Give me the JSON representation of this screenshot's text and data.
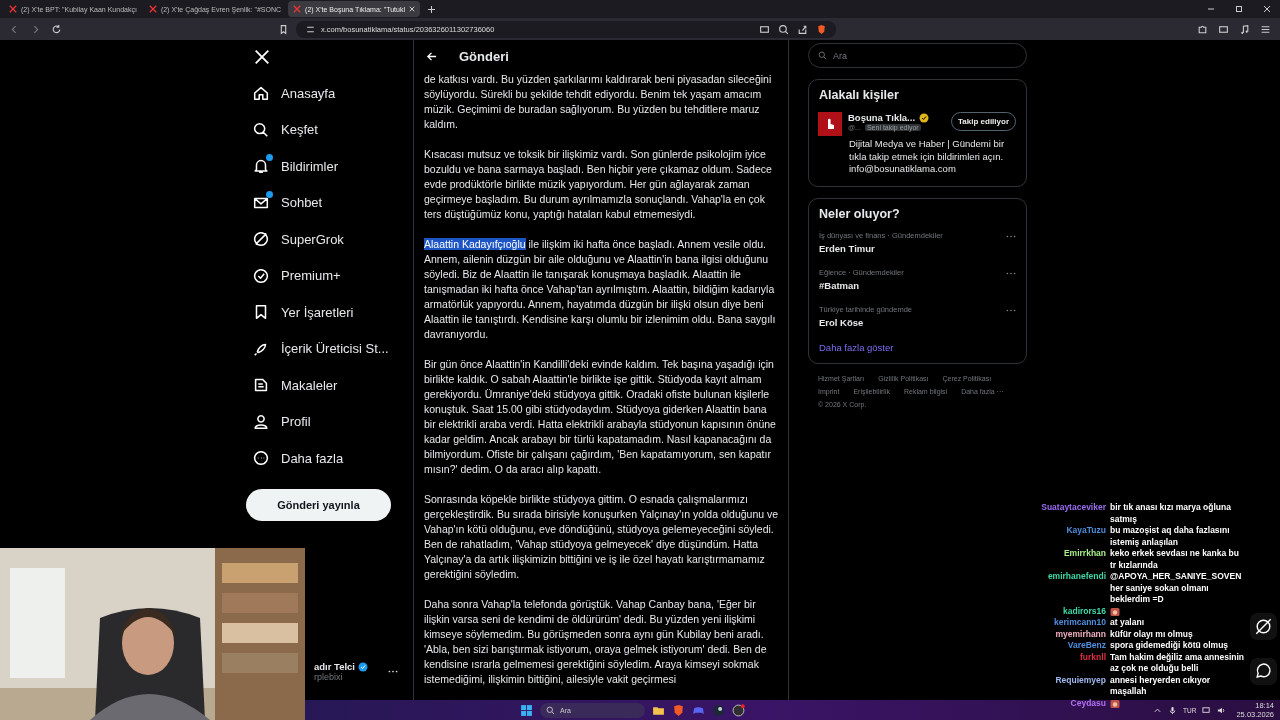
{
  "browser": {
    "tabs": [
      {
        "title": "(2) X'te BPT: \"Kubilay Kaan Kundakçı",
        "selected": false
      },
      {
        "title": "(2) X'te Çağdaş Evren Şenlik: \"#SONC",
        "selected": false
      },
      {
        "title": "(2) X'te Boşuna Tıklama: \"Tutukl",
        "selected": true
      }
    ],
    "url": "x.com/bosunatiklama/status/2036326011302736060"
  },
  "nav": {
    "items": [
      {
        "label": "Anasayfa",
        "badge": false
      },
      {
        "label": "Keşfet",
        "badge": false
      },
      {
        "label": "Bildirimler",
        "badge": true
      },
      {
        "label": "Sohbet",
        "badge": true
      },
      {
        "label": "SuperGrok",
        "badge": false
      },
      {
        "label": "Premium+",
        "badge": false
      },
      {
        "label": "Yer İşaretleri",
        "badge": false
      },
      {
        "label": "İçerik Üreticisi St...",
        "badge": false
      },
      {
        "label": "Makaleler",
        "badge": false
      },
      {
        "label": "Profil",
        "badge": false
      },
      {
        "label": "Daha fazla",
        "badge": false
      }
    ],
    "post_button": "Gönderi yayınla",
    "account": {
      "name": "adır Telci",
      "handle": "rplebixi",
      "verified": true
    }
  },
  "post": {
    "title": "Gönderi",
    "paragraphs": [
      {
        "text": "de katkısı vardı. Bu yüzden şarkılarımı kaldırarak beni piyasadan sileceğini söylüyordu. Sürekli bu şekilde tehdit ediyordu. Benim tek yaşam amacım müzik. Geçimimi de buradan sağlıyorum. Bu yüzden bu tehditlere maruz kaldım."
      },
      {
        "text": "Kısacası mutsuz ve toksik bir ilişkimiz vardı. Son günlerde psikolojim iyice bozuldu ve bana sarmaya başladı. Ben hiçbir yere çıkamaz oldum. Sadece evde prodüktörle birlikte müzik yapıyordum. Her gün ağlayarak zaman geçirmeye başladım. Bu durum ayrılmamızla sonuçlandı. Vahap'la en çok ters düştüğümüz konu, yaptığı hataları kabul etmemesiydi."
      },
      {
        "selected_text": "Alaattin Kadayıfçıoğlu",
        "text": " ile ilişkim iki hafta önce başladı. Annem vesile oldu. Annem, ailenin düzgün bir aile olduğunu ve Alaattin'in bana ilgisi olduğunu söyledi. Biz de Alaattin ile tanışarak konuşmaya başladık. Alaattin ile tanışmadan iki hafta önce Vahap'tan ayrılmıştım. Alaattin, bildiğim kadarıyla armatörlük yapıyordu. Annem, hayatımda düzgün bir ilişki olsun diye beni Alaattin ile tanıştırdı. Kendisine karşı olumlu bir izlenimim oldu. Bana saygılı davranıyordu."
      },
      {
        "text": "Bir gün önce Alaattin'in Kandilli'deki evinde kaldım. Tek başına yaşadığı için birlikte kaldık. O sabah Alaattin'le birlikte işe gittik. Stüdyoda kayıt almam gerekiyordu. Ümraniye'deki stüdyoya gittik. Oradaki ofiste bulunan kişilerle konuştuk. Saat 15.00 gibi stüdyodaydım. Stüdyoya giderken Alaattin bana bir elektrikli araba verdi. Hatta elektrikli arabayla stüdyonun kapısının önüne kadar geldim. Ancak arabayı bir türlü kapatamadım. Nasıl kapanacağını da bilmiyordum. Ofiste bir çalışanı çağırdım, 'Ben kapatamıyorum, sen kapatır mısın?' dedim. O da aracı alıp kapattı."
      },
      {
        "text": "Sonrasında köpekle birlikte stüdyoya gittim. O esnada çalışmalarımızı gerçekleştirdik. Bu sırada birisiyle konuşurken Yalçınay'ın yolda olduğunu ve Vahap'ın kötü olduğunu, eve döndüğünü, stüdyoya gelemeyeceğini söyledi. Ben de rahatladım, 'Vahap stüdyoya gelmeyecek' diye düşündüm. Hatta Yalçınay'a da artık ilişkimizin bittiğini ve iş ile özel hayatı karıştırmamamız gerektiğini söyledim."
      },
      {
        "text": "Daha sonra Vahap'la telefonda görüştük. Vahap Canbay bana, 'Eğer bir ilişkin varsa seni de kendimi de öldürürüm' dedi. Bu yüzden yeni ilişkimi kimseye söylemedim. Bu görüşmeden sonra aynı gün Kubilay beni aradı. 'Abla, ben sizi barıştırmak istiyorum, oraya gelmek istiyorum' dedi. Ben de kendisine ısrarla gelmemesi gerektiğini söyledim. Araya kimseyi sokmak istemediğimi, ilişkimin bittiğini, ailesiyle vakit geçirmesi"
      }
    ]
  },
  "sidebar": {
    "search_placeholder": "Ara",
    "related": {
      "title": "Alakalı kişiler",
      "name": "Boşuna Tıkla...",
      "verified": true,
      "handle": "@...",
      "follows_you": "Seni takip ediyor",
      "follow_button": "Takip ediliyor",
      "bio": "Dijital Medya ve Haber | Gündemi bir tıkla takip etmek için bildirimleri açın. info@bosunatiklama.com"
    },
    "trends": {
      "title": "Neler oluyor?",
      "items": [
        {
          "context": "İş dünyası ve finans · Gündemdekiler",
          "topic": "Erden Timur"
        },
        {
          "context": "Eğlence · Gündemdekiler",
          "topic": "#Batman"
        },
        {
          "context": "Türkiye tarihinde gündemde",
          "topic": "Erol Köse"
        }
      ],
      "more": "Daha fazla göster"
    },
    "footer_links": [
      "Hizmet Şartları",
      "Gizlilik Politikası",
      "Çerez Politikası",
      "Imprint",
      "Erişilebilirlik",
      "Reklam bilgisi",
      "Daha fazla ···"
    ],
    "copyright": "© 2026 X Corp."
  },
  "chat": [
    {
      "user": "Suataytaceviker",
      "color": "#9b6cf0",
      "kind": "text",
      "message": "bir tık anası kızı marya oğluna satmış"
    },
    {
      "user": "KayaTuzu",
      "color": "#4f8fe0",
      "kind": "text",
      "message": "bu mazoşist aq daha fazlasını istemiş anlaşılan"
    },
    {
      "user": "Emirrkhan",
      "color": "#a8f08a",
      "kind": "text",
      "message": "keko erkek sevdası ne kanka bu tr kızlarında"
    },
    {
      "user": "emirhanefendi",
      "color": "#3fd9a8",
      "kind": "text",
      "message": "@APOYA_HER_SANIYE_SOVEN her saniye sokan olmanı beklerdim =D"
    },
    {
      "user": "kadirors16",
      "color": "#3fd9a8",
      "kind": "emote"
    },
    {
      "user": "kerimcann10",
      "color": "#4f8fe0",
      "kind": "text",
      "message": "at yalanı"
    },
    {
      "user": "myemirhann",
      "color": "#f0b0c0",
      "kind": "text",
      "message": "küfür olayı mı olmuş"
    },
    {
      "user": "VareBenz",
      "color": "#4f8fe0",
      "kind": "text",
      "message": "spora gidemediği kötü olmuş"
    },
    {
      "user": "furknll",
      "color": "#e03040",
      "kind": "text",
      "message": "Tam hakim değiliz ama annesinin az çok ne olduğu belli"
    },
    {
      "user": "Requiemyep",
      "color": "#a0b8f0",
      "kind": "text",
      "message": "annesi heryerden cıkıyor maşallah"
    },
    {
      "user": "Ceydasu",
      "color": "#b070f0",
      "kind": "emote"
    }
  ],
  "taskbar": {
    "search_placeholder": "Ara",
    "language": "TUR",
    "time": "18:14",
    "date": "25.03.2026"
  }
}
